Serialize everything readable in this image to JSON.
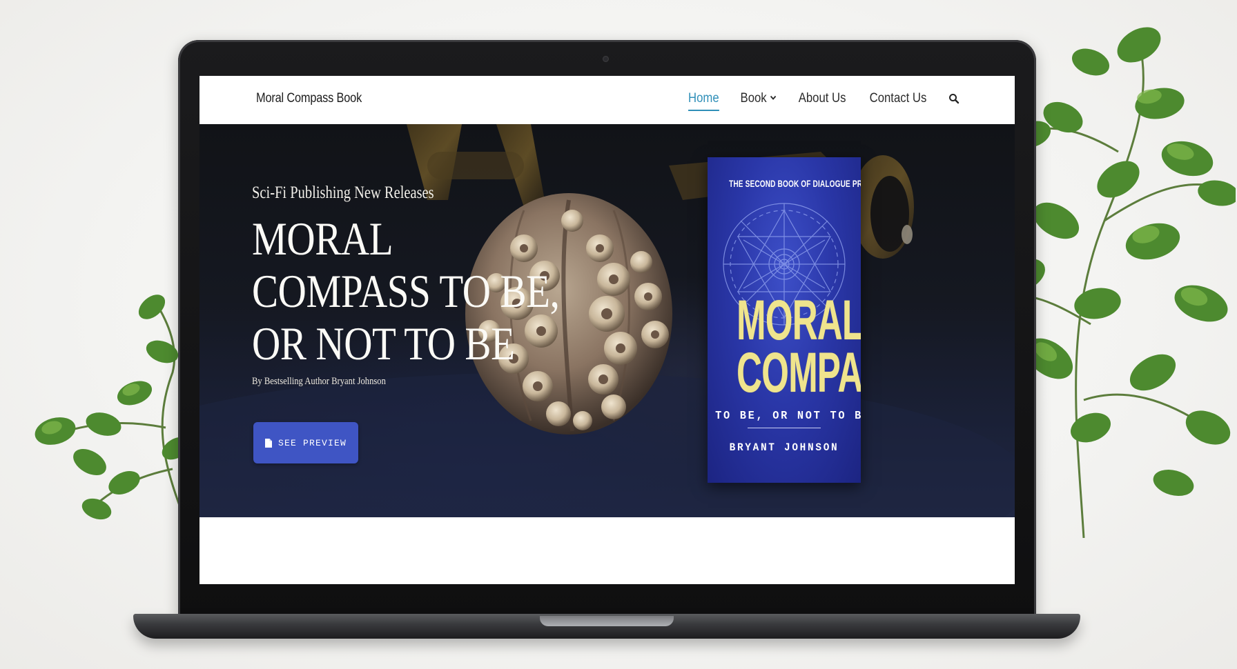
{
  "site": {
    "brand": "Moral Compass Book",
    "nav": {
      "home": "Home",
      "book": "Book",
      "about": "About Us",
      "contact": "Contact Us",
      "search_icon": "search-icon",
      "book_dropdown_icon": "chevron-down-icon"
    }
  },
  "hero": {
    "subtitle": "Sci-Fi Publishing New Releases",
    "title": "MORAL COMPASS TO BE, OR NOT TO BE",
    "byline": "By Bestselling Author Bryant Johnson",
    "button": {
      "label": "SEE PREVIEW",
      "icon": "document-icon"
    }
  },
  "book_cover": {
    "top_text": "THE SECOND BOOK OF DIALOGUE PROMPT",
    "title_line1": "MORAL",
    "title_line2": "COMPASS",
    "subtitle": "TO BE, OR NOT TO BE",
    "author": "BRYANT JOHNSON"
  },
  "colors": {
    "accent": "#2f8fb8",
    "button": "#3f55c4",
    "cover_blue": "#2a37a8",
    "cover_title": "#efe48d"
  }
}
